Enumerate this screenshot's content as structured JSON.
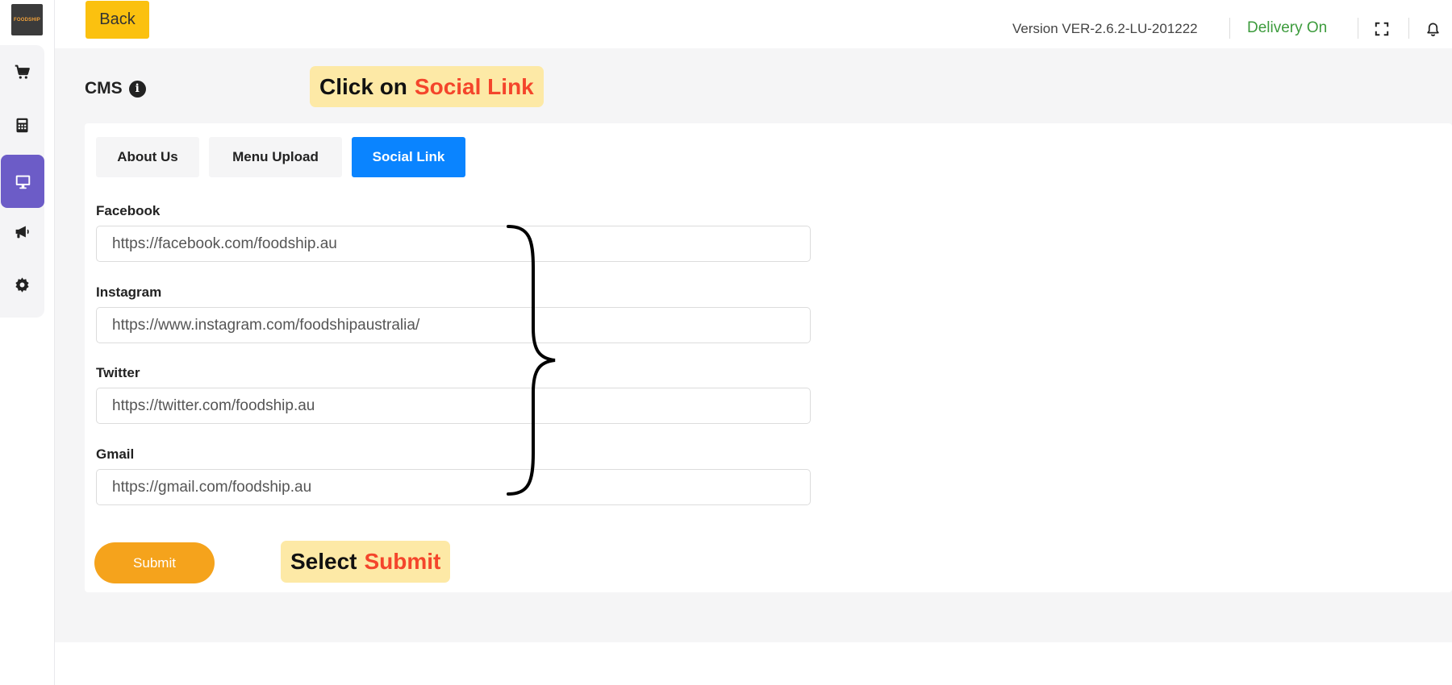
{
  "app": {
    "logo_text": "FOODSHIP"
  },
  "sidebar": {
    "items": [
      {
        "name": "cart-icon",
        "active": false
      },
      {
        "name": "calculator-icon",
        "active": false
      },
      {
        "name": "monitor-icon",
        "active": true
      },
      {
        "name": "megaphone-icon",
        "active": false
      },
      {
        "name": "gear-icon",
        "active": false
      }
    ]
  },
  "header": {
    "back_label": "Back",
    "version": "Version VER-2.6.2-LU-201222",
    "delivery_status": "Delivery On",
    "icons": [
      "fullscreen-icon",
      "bell-icon"
    ]
  },
  "page": {
    "title": "CMS",
    "info_icon": "info-icon"
  },
  "callouts": {
    "top": {
      "prefix": "Click on",
      "accent": "Social Link"
    },
    "bottom": {
      "prefix": "Select",
      "accent": "Submit"
    }
  },
  "tabs": [
    {
      "label": "About Us",
      "active": false
    },
    {
      "label": "Menu Upload",
      "active": false
    },
    {
      "label": "Social Link",
      "active": true
    }
  ],
  "form": {
    "fields": [
      {
        "label": "Facebook",
        "value": "https://facebook.com/foodship.au"
      },
      {
        "label": "Instagram",
        "value": "https://www.instagram.com/foodshipaustralia/"
      },
      {
        "label": "Twitter",
        "value": "https://twitter.com/foodship.au"
      },
      {
        "label": "Gmail",
        "value": "https://gmail.com/foodship.au"
      }
    ],
    "submit_label": "Submit"
  },
  "colors": {
    "back_button": "#fbc10f",
    "active_tab": "#0a84ff",
    "sidebar_active": "#6c5cc7",
    "delivery": "#3c9b3c",
    "submit": "#f5a31c",
    "callout_bg": "#fde9a6",
    "callout_accent": "#f4452b"
  }
}
